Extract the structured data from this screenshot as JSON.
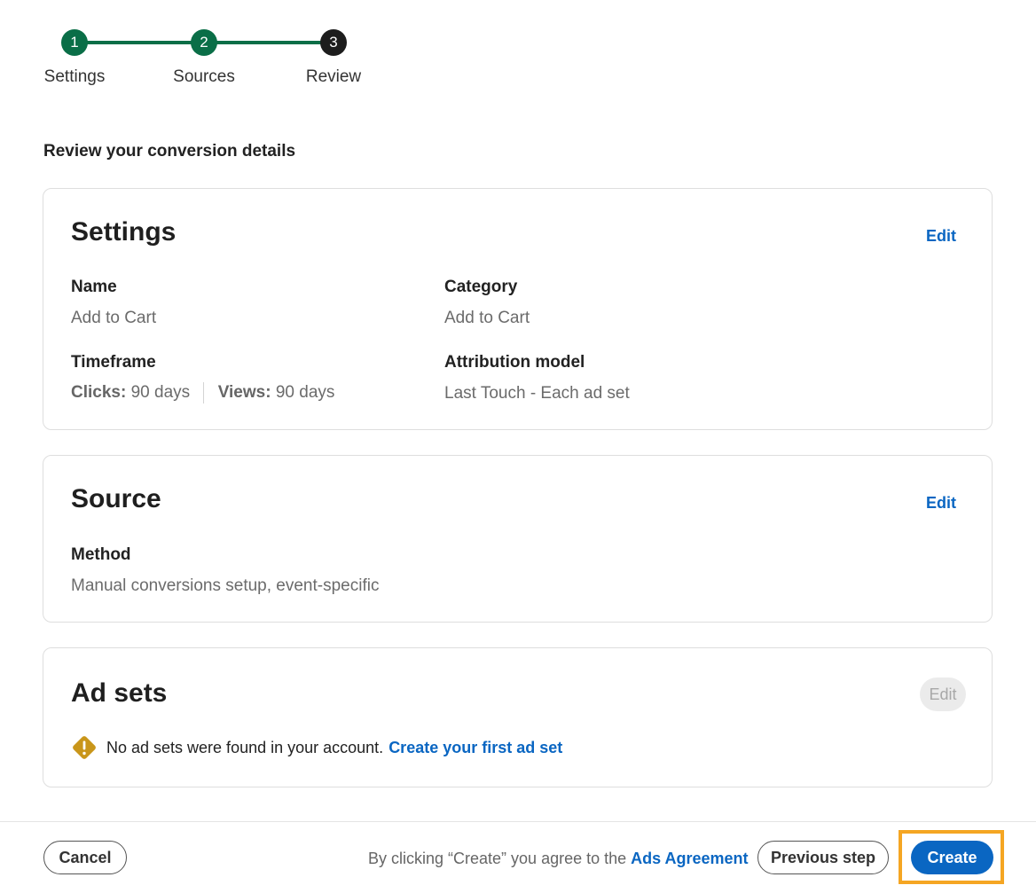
{
  "stepper": {
    "steps": [
      {
        "number": "1",
        "label": "Settings",
        "state": "done"
      },
      {
        "number": "2",
        "label": "Sources",
        "state": "done"
      },
      {
        "number": "3",
        "label": "Review",
        "state": "current"
      }
    ]
  },
  "page": {
    "heading": "Review your conversion details"
  },
  "settings_card": {
    "title": "Settings",
    "edit_label": "Edit",
    "name_label": "Name",
    "name_value": "Add to Cart",
    "category_label": "Category",
    "category_value": "Add to Cart",
    "timeframe_label": "Timeframe",
    "clicks_label": "Clicks:",
    "clicks_value": "90 days",
    "views_label": "Views:",
    "views_value": "90 days",
    "attribution_label": "Attribution model",
    "attribution_value": "Last Touch - Each ad set"
  },
  "source_card": {
    "title": "Source",
    "edit_label": "Edit",
    "method_label": "Method",
    "method_value": "Manual conversions setup, event-specific"
  },
  "adsets_card": {
    "title": "Ad sets",
    "edit_label": "Edit",
    "warning_text": "No ad sets were found in your account.",
    "warning_link": "Create your first ad set"
  },
  "footer": {
    "cancel_label": "Cancel",
    "agree_text": "By clicking “Create” you agree to the",
    "agree_link": "Ads Agreement",
    "previous_label": "Previous step",
    "create_label": "Create"
  },
  "colors": {
    "accent": "#0a66c2",
    "step_done": "#0a6e47",
    "step_current": "#1d1d1d",
    "warning": "#c9961a",
    "highlight": "#f5a623"
  },
  "icons": {
    "warning": "warning-diamond-icon"
  }
}
